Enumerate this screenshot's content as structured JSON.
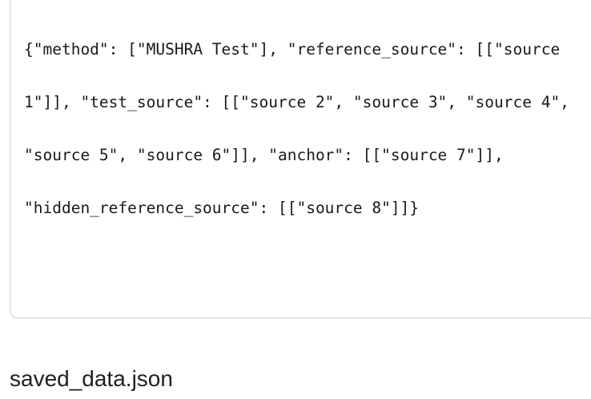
{
  "editor": {
    "lines": [
      "{\"method\": [\"MUSHRA Test\"], \"reference_source\": [[\"source",
      "1\"]], \"test_source\": [[\"source 2\", \"source 3\", \"source 4\",",
      "\"source 5\", \"source 6\"]], \"anchor\": [[\"source 7\"]],",
      "\"hidden_reference_source\": [[\"source 8\"]]}"
    ]
  },
  "file": {
    "title": "saved_data.json"
  }
}
